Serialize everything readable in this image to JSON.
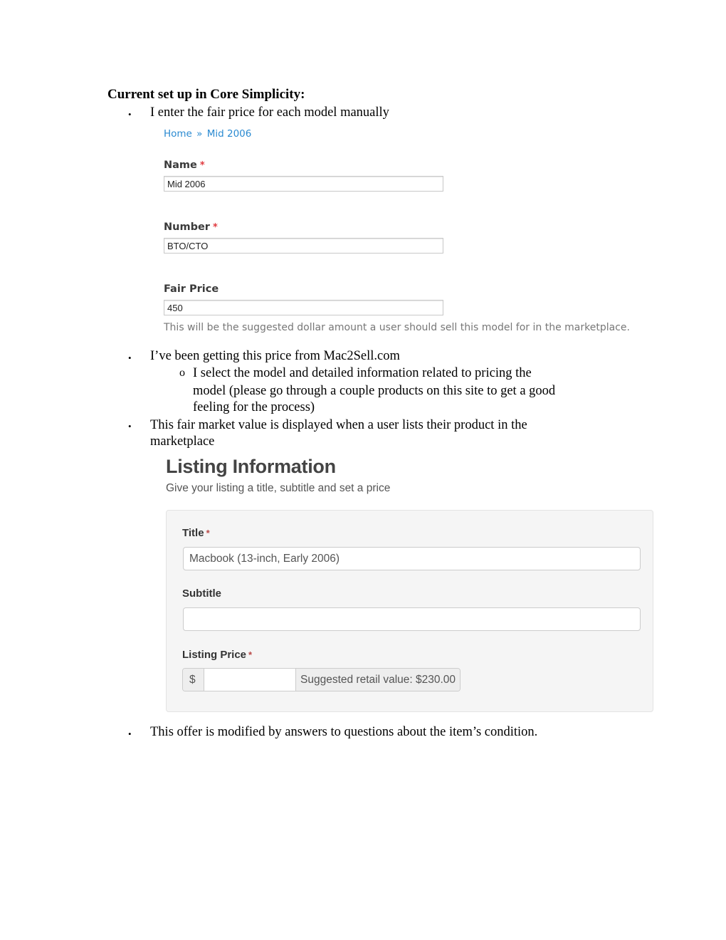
{
  "document": {
    "heading": "Current set up in Core Simplicity:",
    "bullets": [
      "I enter the fair price for each model manually",
      "I’ve been getting this price from Mac2Sell.com",
      "This fair market value is displayed when a user lists their product in the marketplace",
      "This offer is modified by answers to questions about the item’s condition."
    ],
    "sub_bullet": {
      "marker": "o",
      "lines": [
        "I select the model and detailed information related to pricing the",
        "model (please go through a couple products on this site to get a good",
        "feeling for the process)"
      ]
    },
    "bullet_3_lines": [
      "This fair market value is displayed when a user lists their product in the",
      "marketplace"
    ],
    "bullet_marker": "•"
  },
  "model_form": {
    "breadcrumb": [
      {
        "label": "Home"
      },
      {
        "label": "Mid 2006"
      }
    ],
    "breadcrumb_separator": "»",
    "required_marker": "*",
    "fields": [
      {
        "label": "Name",
        "value": "Mid 2006",
        "required": true
      },
      {
        "label": "Number",
        "value": "BTO/CTO",
        "required": true
      },
      {
        "label": "Fair Price",
        "value": "450",
        "required": false
      }
    ],
    "fair_price_description": "This will be the suggested dollar amount a user should sell this model for in the marketplace."
  },
  "listing": {
    "title": "Listing Information",
    "subtitle": "Give your listing a title, subtitle and set a price",
    "required_marker": "*",
    "fields": {
      "title": {
        "label": "Title",
        "value": "Macbook (13-inch, Early 2006)"
      },
      "subtitle": {
        "label": "Subtitle",
        "value": ""
      },
      "price": {
        "label": "Listing Price",
        "currency": "$",
        "value": "",
        "suggested": "Suggested retail value: $230.00"
      }
    }
  }
}
